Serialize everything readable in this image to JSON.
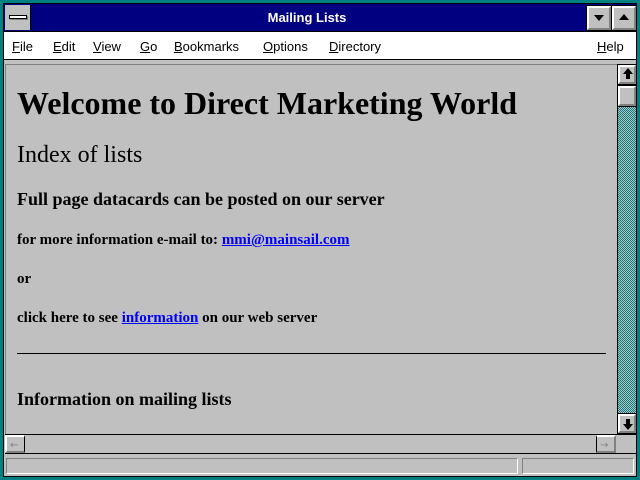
{
  "window": {
    "title": "Mailing Lists"
  },
  "menu": {
    "items": [
      "File",
      "Edit",
      "View",
      "Go",
      "Bookmarks",
      "Options",
      "Directory"
    ],
    "help": "Help"
  },
  "page": {
    "heading": "Welcome to Direct Marketing World",
    "subheading": "Index of lists",
    "datacards": "Full page datacards can be posted on our server",
    "email_prefix": "for more information e-mail to: ",
    "email_link": "mmi@mainsail.com",
    "or": "or",
    "click_prefix": "click here to see ",
    "info_link": "information",
    "click_suffix": " on our web server",
    "section": "Information on mailing lists"
  },
  "status": {
    "text": ""
  },
  "colors": {
    "titlebar": "#000080",
    "link": "#0000ff",
    "frame": "#008080",
    "surface": "#c0c0c0"
  },
  "icons": {
    "system_menu": "system-menu-icon",
    "minimize": "minimize-arrow-icon",
    "maximize": "maximize-arrow-icon",
    "scroll_up": "scroll-up-arrow-icon",
    "scroll_down": "scroll-down-arrow-icon",
    "scroll_left": "scroll-left-arrow-icon",
    "scroll_right": "scroll-right-arrow-icon"
  }
}
